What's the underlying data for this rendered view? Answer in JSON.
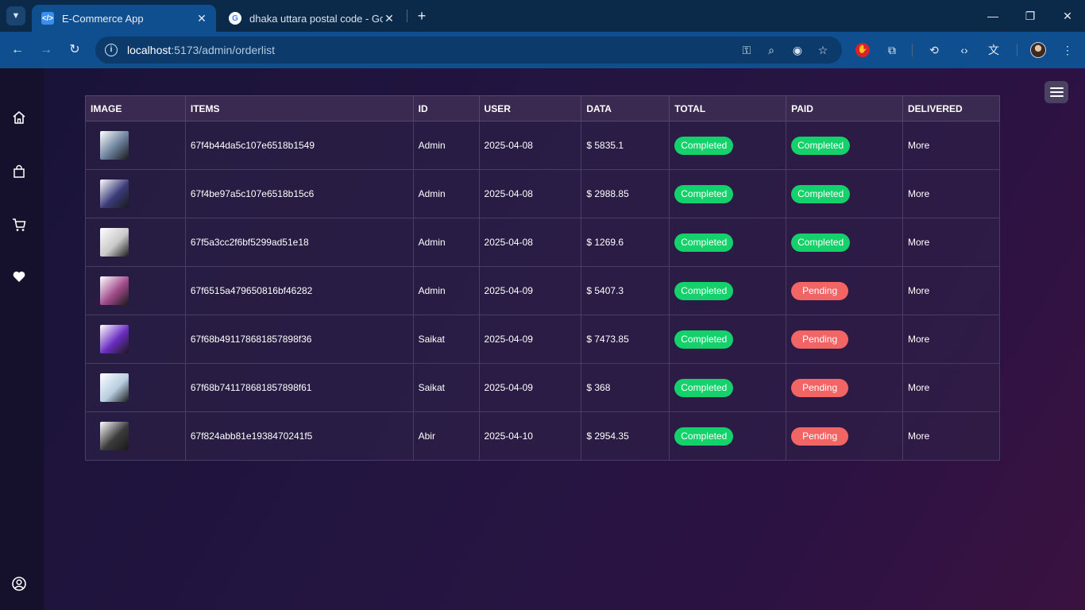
{
  "browser": {
    "tabs": [
      {
        "title": "E-Commerce App",
        "active": true
      },
      {
        "title": "dhaka uttara postal code - Goo",
        "active": false
      }
    ],
    "url_host": "localhost",
    "url_rest": ":5173/admin/orderlist"
  },
  "sidebar": {
    "items": [
      {
        "icon": "home-icon"
      },
      {
        "icon": "shopping-bag-icon"
      },
      {
        "icon": "cart-icon"
      },
      {
        "icon": "heart-icon"
      }
    ],
    "bottom_icon": "user-circle-icon"
  },
  "table": {
    "headers": [
      "IMAGE",
      "ITEMS",
      "ID",
      "USER",
      "DATA",
      "TOTAL",
      "PAID",
      "DELIVERED"
    ],
    "rows": [
      {
        "item_id": "67f4b44da5c107e6518b1549",
        "user": "Admin",
        "date": "2025-04-08",
        "amount": "$ 5835.1",
        "total": "Completed",
        "paid": "Completed",
        "delivered": "More",
        "thumb": "#6a7f9a"
      },
      {
        "item_id": "67f4be97a5c107e6518b15c6",
        "user": "Admin",
        "date": "2025-04-08",
        "amount": "$ 2988.85",
        "total": "Completed",
        "paid": "Completed",
        "delivered": "More",
        "thumb": "#3b3a7a"
      },
      {
        "item_id": "67f5a3cc2f6bf5299ad51e18",
        "user": "Admin",
        "date": "2025-04-08",
        "amount": "$ 1269.6",
        "total": "Completed",
        "paid": "Completed",
        "delivered": "More",
        "thumb": "#c9c9c9"
      },
      {
        "item_id": "67f6515a479650816bf46282",
        "user": "Admin",
        "date": "2025-04-09",
        "amount": "$ 5407.3",
        "total": "Completed",
        "paid": "Pending",
        "delivered": "More",
        "thumb": "#a04a8a"
      },
      {
        "item_id": "67f68b491178681857898f36",
        "user": "Saikat",
        "date": "2025-04-09",
        "amount": "$ 7473.85",
        "total": "Completed",
        "paid": "Pending",
        "delivered": "More",
        "thumb": "#6a2cc0"
      },
      {
        "item_id": "67f68b741178681857898f61",
        "user": "Saikat",
        "date": "2025-04-09",
        "amount": "$ 368",
        "total": "Completed",
        "paid": "Pending",
        "delivered": "More",
        "thumb": "#b8cde0"
      },
      {
        "item_id": "67f824abb81e1938470241f5",
        "user": "Abir",
        "date": "2025-04-10",
        "amount": "$ 2954.35",
        "total": "Completed",
        "paid": "Pending",
        "delivered": "More",
        "thumb": "#3a3a3a"
      }
    ]
  },
  "colors": {
    "completed": "#14d16b",
    "pending": "#f26565",
    "browser_toolbar": "#0f4f8f"
  }
}
